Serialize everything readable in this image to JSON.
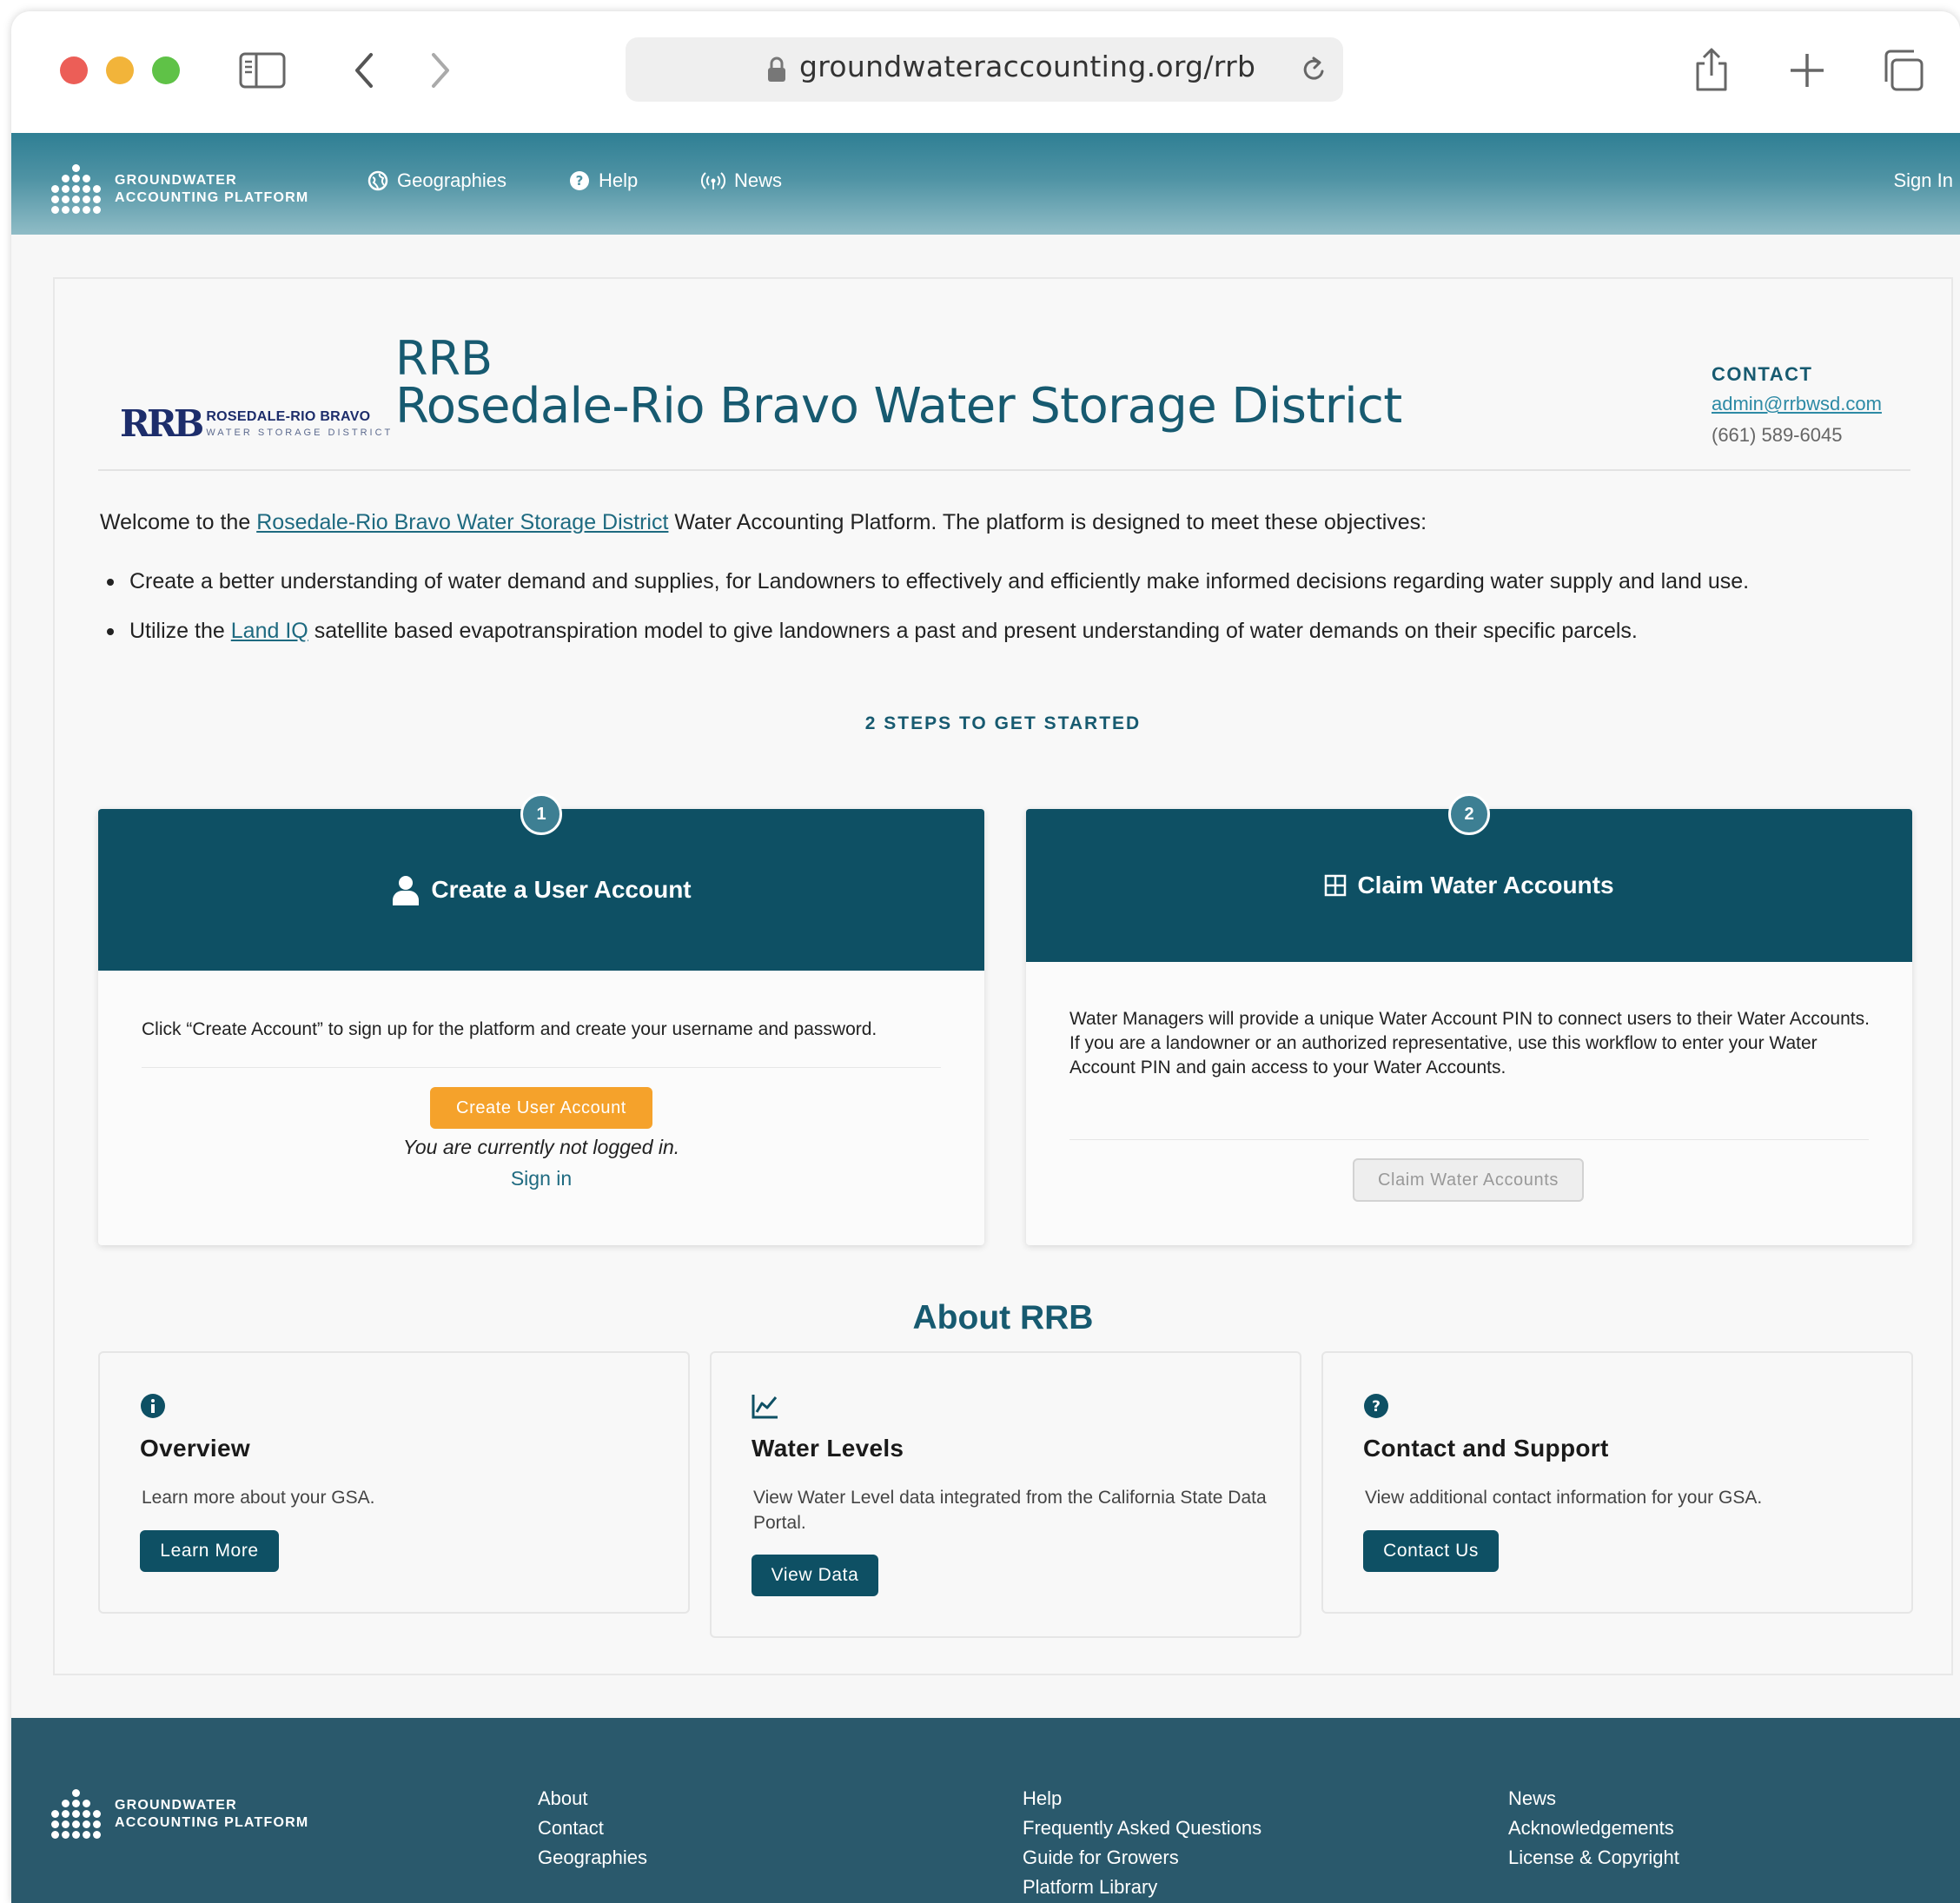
{
  "browser": {
    "url": "groundwateraccounting.org/rrb"
  },
  "nav": {
    "brand_line1": "GROUNDWATER",
    "brand_line2": "ACCOUNTING PLATFORM",
    "items": [
      "Geographies",
      "Help",
      "News"
    ],
    "sign_in": "Sign In"
  },
  "header": {
    "logo_mark": "RRB",
    "logo_line1": "ROSEDALE-RIO BRAVO",
    "logo_line2": "WATER STORAGE DISTRICT",
    "abbr": "RRB",
    "name": "Rosedale-Rio Bravo Water Storage District",
    "contact_label": "CONTACT",
    "contact_email": "admin@rrbwsd.com",
    "contact_phone": "(661) 589-6045"
  },
  "intro": {
    "welcome_pre": "Welcome to the ",
    "welcome_link": "Rosedale-Rio Bravo Water Storage District",
    "welcome_post": " Water Accounting Platform. The platform is designed to meet these objectives:",
    "bullet1": "Create a better understanding of water demand and supplies, for Landowners to effectively and efficiently make informed decisions regarding water supply and land use.",
    "bullet2_pre": "Utilize the ",
    "bullet2_link": "Land IQ",
    "bullet2_post": " satellite based evapotranspiration model to give landowners a past and present understanding of water demands on their specific parcels."
  },
  "steps": {
    "title": "2 STEPS TO GET STARTED",
    "step1": {
      "number": "1",
      "heading": "Create a User Account",
      "text": "Click “Create Account” to sign up for the platform and create your username and password.",
      "button": "Create User Account",
      "status": "You are currently not logged in.",
      "signin": "Sign in"
    },
    "step2": {
      "number": "2",
      "heading": "Claim Water Accounts",
      "text": "Water Managers will provide a unique Water Account PIN to connect users to their Water Accounts. If you are a landowner or an authorized representative, use this workflow to enter your Water Account PIN and gain access to your Water Accounts.",
      "button": "Claim Water Accounts"
    }
  },
  "about": {
    "title": "About RRB",
    "cards": [
      {
        "title": "Overview",
        "text": "Learn more about your GSA.",
        "button": "Learn More"
      },
      {
        "title": "Water Levels",
        "text": "View Water Level data integrated from the California State Data Portal.",
        "button": "View Data"
      },
      {
        "title": "Contact and Support",
        "text": "View additional contact information for your GSA.",
        "button": "Contact Us"
      }
    ]
  },
  "footer": {
    "brand_line1": "GROUNDWATER",
    "brand_line2": "ACCOUNTING PLATFORM",
    "col1": [
      "About",
      "Contact",
      "Geographies"
    ],
    "col2": [
      "Help",
      "Frequently Asked Questions",
      "Guide for Growers",
      "Platform Library"
    ],
    "col3": [
      "News",
      "Acknowledgements",
      "License & Copyright"
    ]
  },
  "colors": {
    "primary": "#0e5064",
    "accent_orange": "#f5a22b",
    "title_teal": "#175a70",
    "footer_bg": "#2a596c"
  }
}
